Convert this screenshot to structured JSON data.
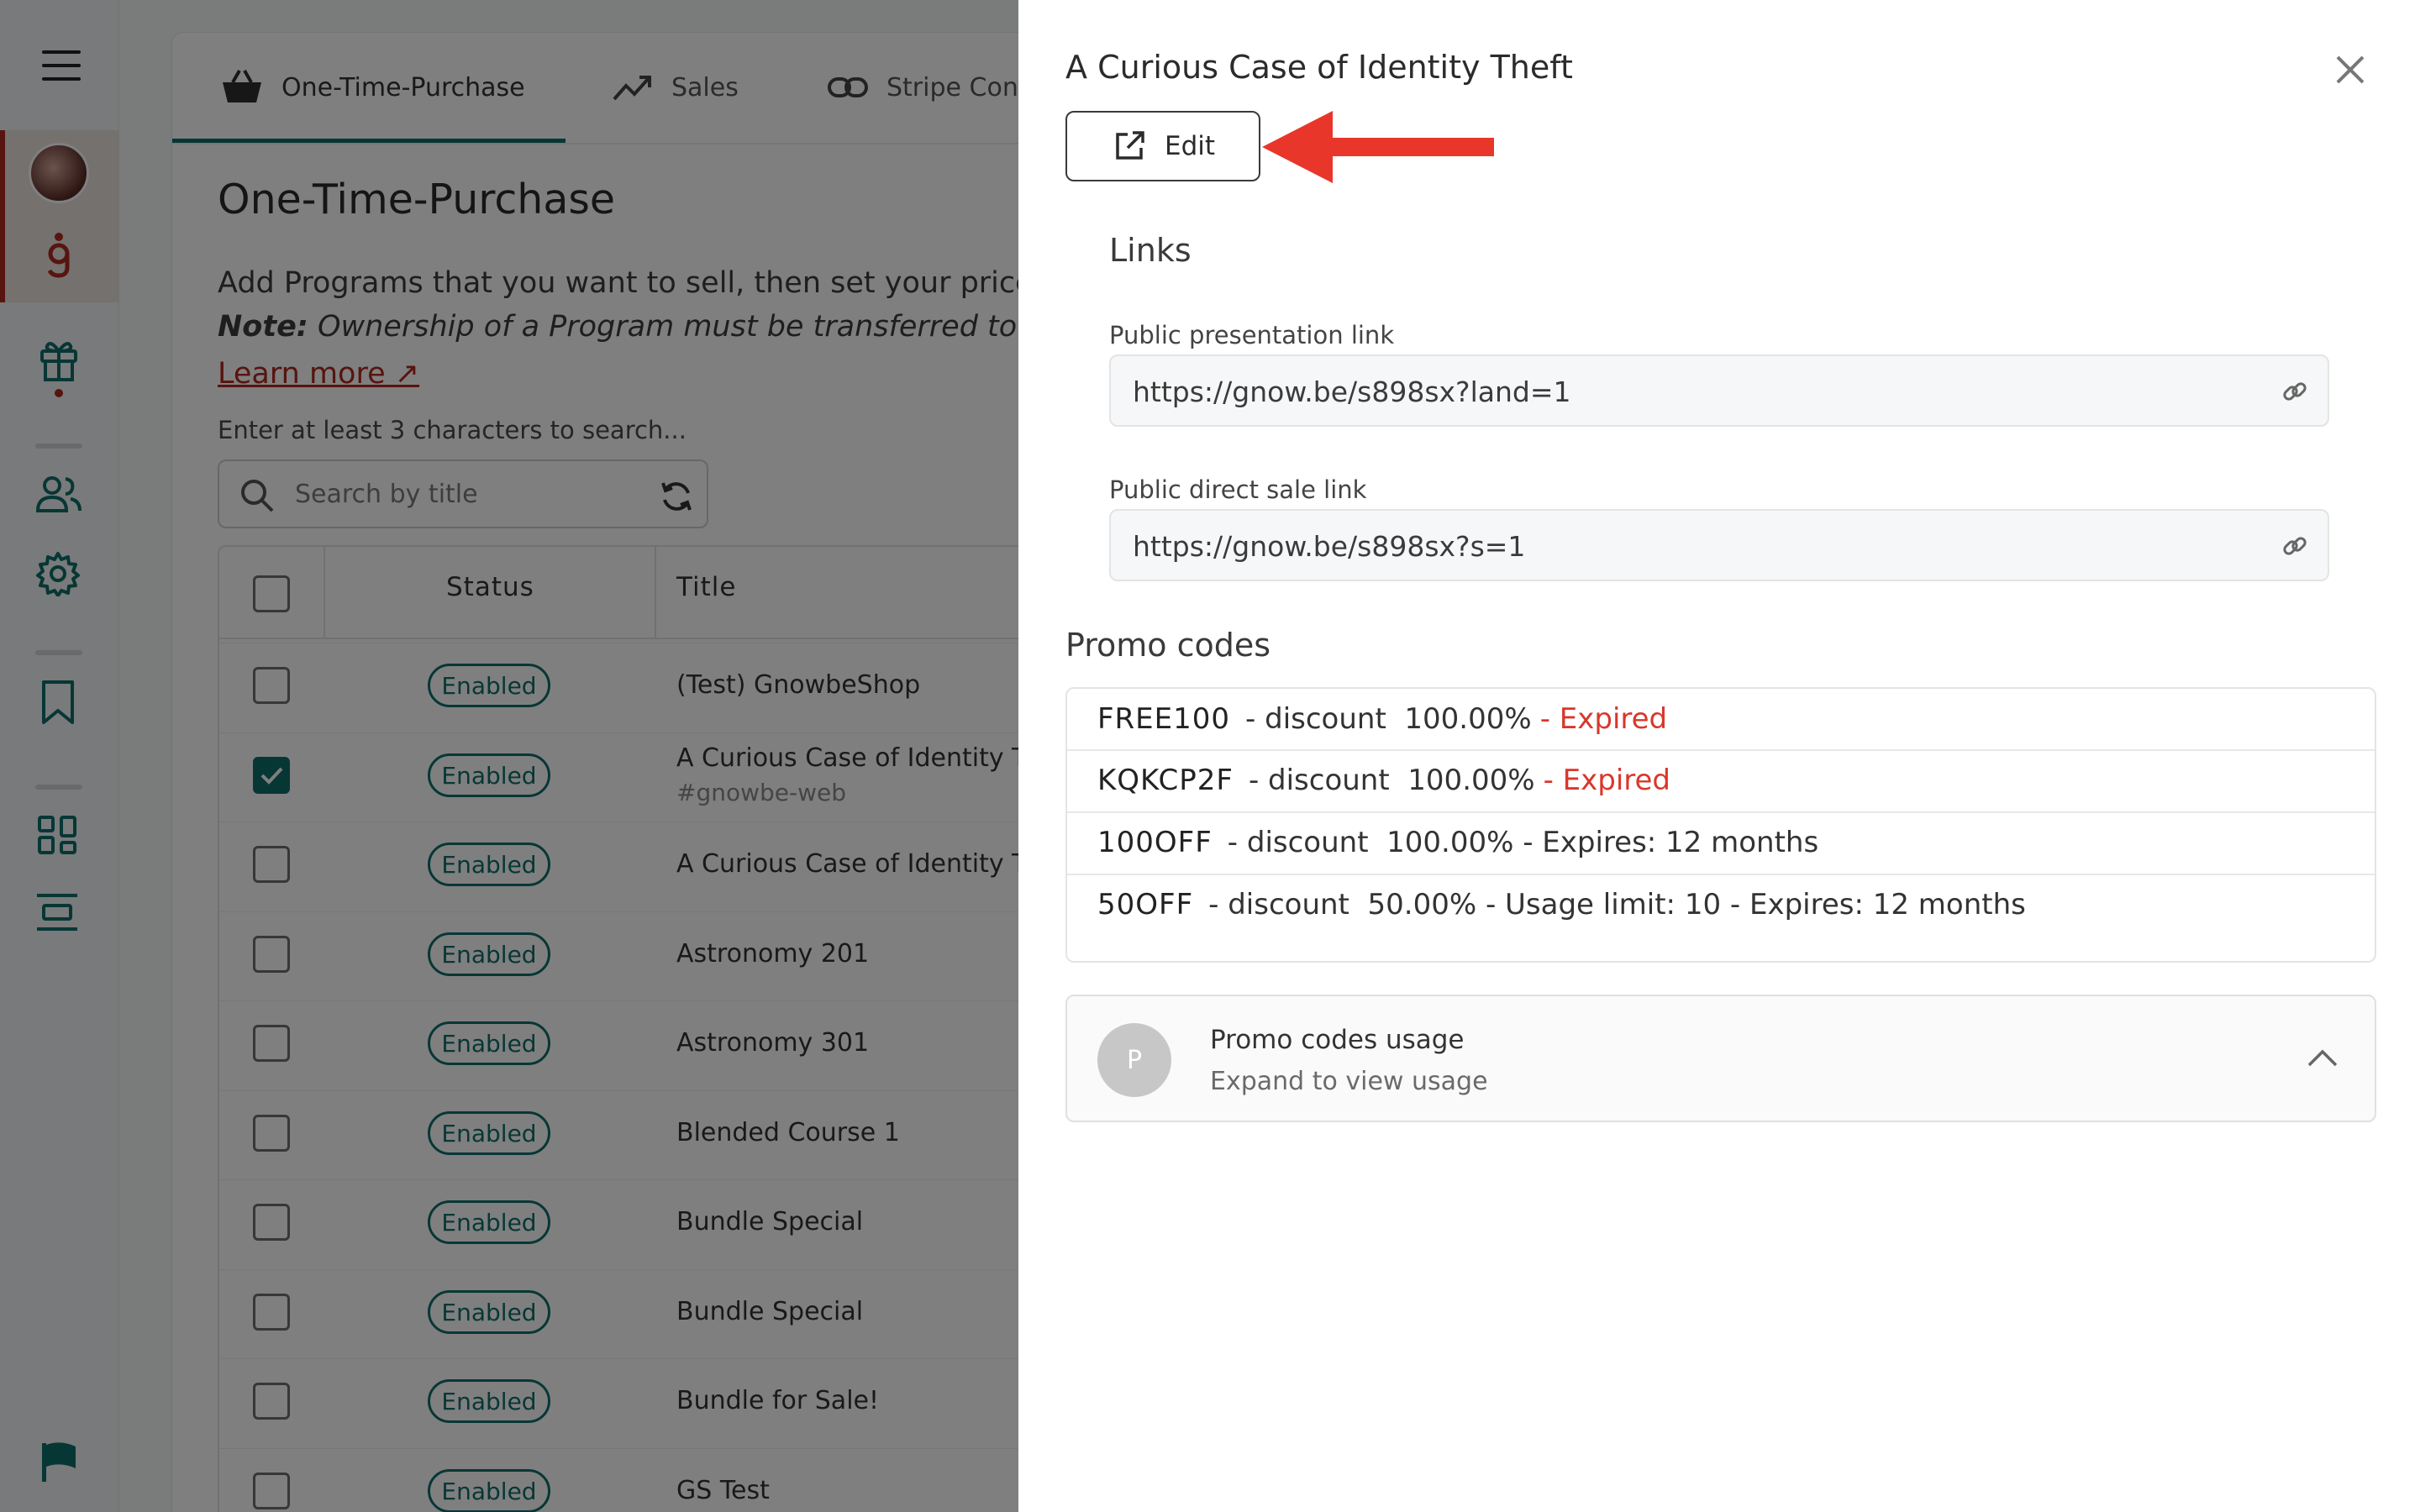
{
  "tabs": [
    {
      "label": "One-Time-Purchase",
      "icon": "basket-icon",
      "active": true
    },
    {
      "label": "Sales",
      "icon": "trending-up-icon",
      "active": false
    },
    {
      "label": "Stripe Conn",
      "icon": "link-icon",
      "active": false
    }
  ],
  "page": {
    "title": "One-Time-Purchase",
    "description": "Add Programs that you want to sell, then set your price to a",
    "note_label": "Note:",
    "note_text": "Ownership of a Program must be transferred to your",
    "learn_more": "Learn more ↗",
    "search_hint": "Enter at least 3 characters to search...",
    "search_placeholder": "Search by title"
  },
  "table": {
    "columns": [
      "Status",
      "Title"
    ],
    "rows": [
      {
        "checked": false,
        "status": "Enabled",
        "title": "(Test) GnowbeShop",
        "subtitle": ""
      },
      {
        "checked": true,
        "status": "Enabled",
        "title": "A Curious Case of Identity Th",
        "subtitle": "#gnowbe-web"
      },
      {
        "checked": false,
        "status": "Enabled",
        "title": "A Curious Case of Identity Th",
        "subtitle": ""
      },
      {
        "checked": false,
        "status": "Enabled",
        "title": "Astronomy 201",
        "subtitle": ""
      },
      {
        "checked": false,
        "status": "Enabled",
        "title": "Astronomy 301",
        "subtitle": ""
      },
      {
        "checked": false,
        "status": "Enabled",
        "title": "Blended Course 1",
        "subtitle": ""
      },
      {
        "checked": false,
        "status": "Enabled",
        "title": "Bundle Special",
        "subtitle": ""
      },
      {
        "checked": false,
        "status": "Enabled",
        "title": "Bundle Special",
        "subtitle": ""
      },
      {
        "checked": false,
        "status": "Enabled",
        "title": "Bundle for Sale!",
        "subtitle": ""
      },
      {
        "checked": false,
        "status": "Enabled",
        "title": "GS Test",
        "subtitle": ""
      }
    ]
  },
  "drawer": {
    "title": "A Curious Case of Identity Theft",
    "edit_label": "Edit",
    "links_heading": "Links",
    "public_presentation_label": "Public presentation link",
    "public_presentation_value": "https://gnow.be/s898sx?land=1",
    "public_direct_sale_label": "Public direct sale link",
    "public_direct_sale_value": "https://gnow.be/s898sx?s=1",
    "promo_heading": "Promo codes",
    "promo_codes": [
      {
        "code": "FREE100",
        "details": "- discount  100.00%",
        "expired": "- Expired"
      },
      {
        "code": "KQKCP2F",
        "details": "- discount  100.00%",
        "expired": "- Expired"
      },
      {
        "code": "100OFF",
        "details": "- discount  100.00% - Expires: 12 months",
        "expired": ""
      },
      {
        "code": "50OFF",
        "details": "- discount  50.00% - Usage limit: 10 - Expires: 12 months",
        "expired": ""
      }
    ],
    "usage_avatar": "P",
    "usage_title": "Promo codes usage",
    "usage_subtitle": "Expand to view usage"
  },
  "colors": {
    "accent": "#0f6e6a",
    "brand_red": "#b0281e",
    "expired_red": "#d9372b",
    "annotation_arrow": "#e8372a"
  }
}
